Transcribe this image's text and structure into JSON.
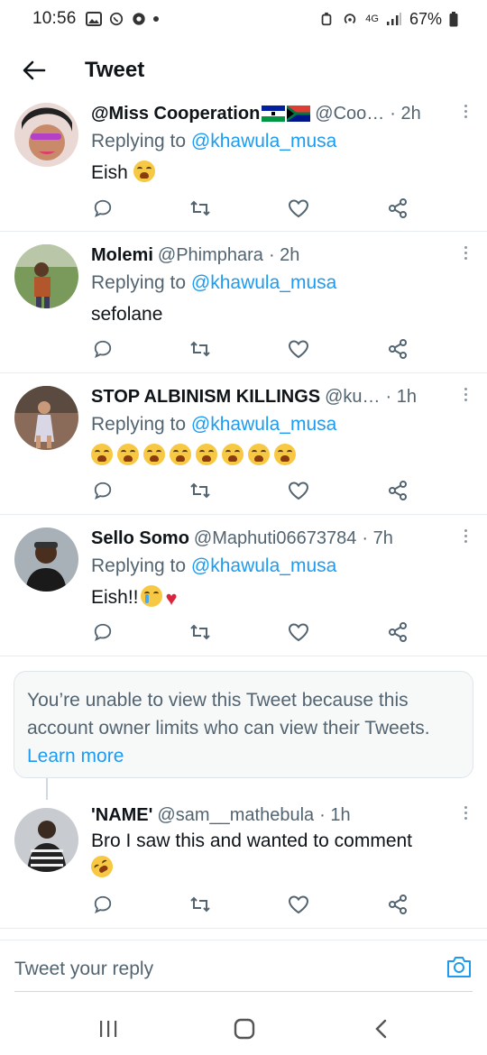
{
  "status_bar": {
    "time": "10:56",
    "battery": "67%",
    "network": "4G"
  },
  "header": {
    "title": "Tweet"
  },
  "tweets": [
    {
      "name": "@Miss Cooperation",
      "flags": [
        "Lesotho flag",
        "South Africa flag"
      ],
      "handle": "@Coo…",
      "time": "· 2h",
      "reply_prefix": "Replying to",
      "reply_to": "@khawula_musa",
      "text": "Eish",
      "emoji": [
        "loudly-crying-face"
      ]
    },
    {
      "name": "Molemi",
      "handle": "@Phimphara",
      "time": "· 2h",
      "reply_prefix": "Replying to",
      "reply_to": "@khawula_musa",
      "text": "sefolane"
    },
    {
      "name": "STOP ALBINISM KILLINGS",
      "handle": "@ku…",
      "time": "· 1h",
      "reply_prefix": "Replying to",
      "reply_to": "@khawula_musa",
      "emoji_count": 8,
      "emoji": [
        "loudly-crying-face"
      ]
    },
    {
      "name": "Sello Somo",
      "handle": "@Maphuti06673784",
      "time": "· 7h",
      "reply_prefix": "Replying to",
      "reply_to": "@khawula_musa",
      "text": "Eish!!",
      "emoji": [
        "crying-face",
        "broken-heart"
      ]
    }
  ],
  "restricted": {
    "message": "You’re unable to view this Tweet because this account owner limits who can view their Tweets.",
    "link": "Learn more"
  },
  "last_tweet": {
    "name": "'NAME'",
    "handle": "@sam__mathebula",
    "time": "· 1h",
    "text": "Bro I saw this and wanted to comment",
    "emoji": [
      "rolling-on-floor-laughing"
    ]
  },
  "reply_bar": {
    "placeholder": "Tweet your reply"
  },
  "icons": {
    "reply": "reply-icon",
    "retweet": "retweet-icon",
    "like": "heart-icon",
    "share": "share-icon",
    "accent": "#1d9bf0",
    "muted": "#536471"
  }
}
